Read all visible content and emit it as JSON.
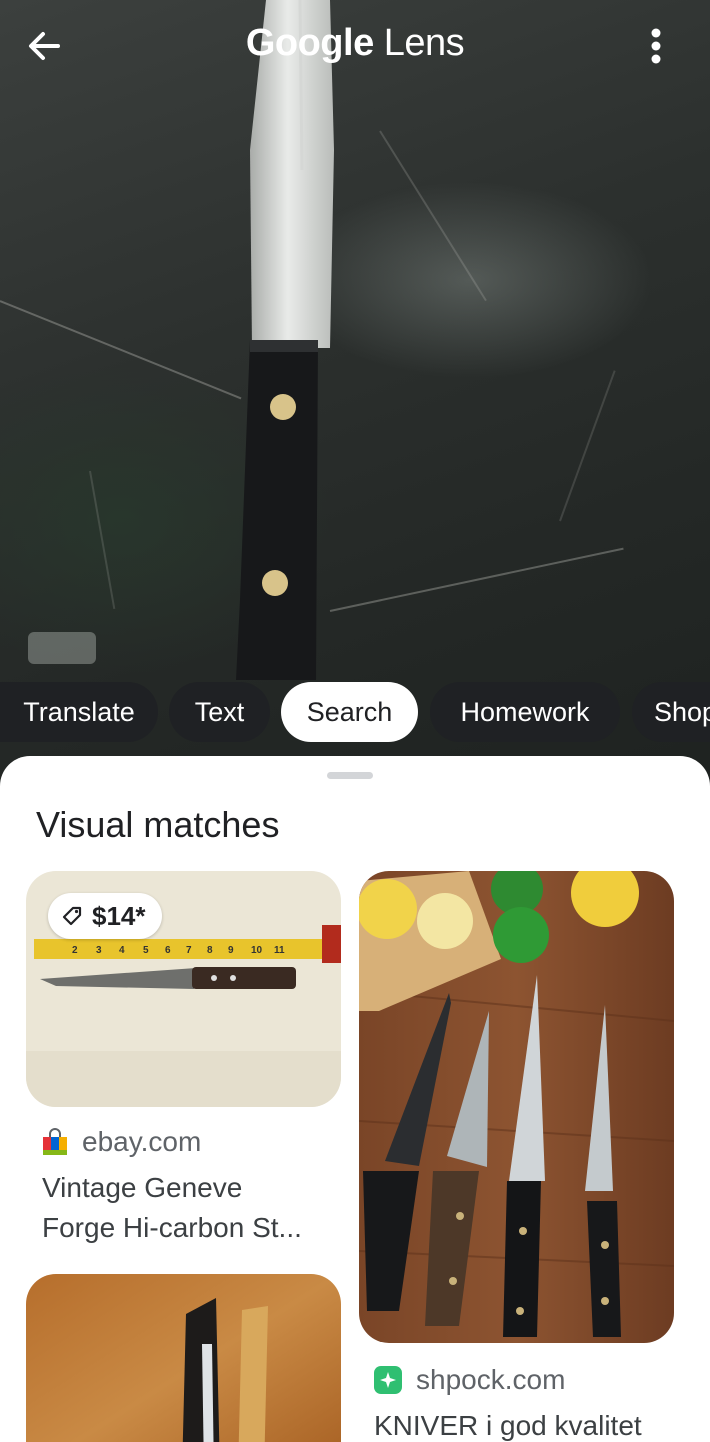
{
  "header": {
    "brand": "Google",
    "product": "Lens"
  },
  "icons": {
    "back": "arrow-left-icon",
    "menu": "more-vert-icon",
    "price": "tag-icon",
    "ebay": "shopping-bag-icon",
    "shpock": "shpock-icon"
  },
  "chips": [
    {
      "label": "Translate",
      "active": false
    },
    {
      "label": "Text",
      "active": false
    },
    {
      "label": "Search",
      "active": true
    },
    {
      "label": "Homework",
      "active": false
    },
    {
      "label": "Shopping",
      "active": false
    }
  ],
  "sheet": {
    "title": "Visual matches"
  },
  "results": [
    {
      "price": "$14*",
      "source": "ebay.com",
      "title_line1": "Vintage Geneve",
      "title_line2": "Forge Hi-carbon St..."
    },
    {
      "source": "shpock.com",
      "title_line1": "KNIVER i god kvalitet"
    }
  ],
  "ruler_marks": [
    "2",
    "3",
    "4",
    "5",
    "6",
    "7",
    "8",
    "9",
    "10",
    "11"
  ],
  "colors": {
    "chip_bg": "#1f2124",
    "chip_active_bg": "#ffffff",
    "shpock_green": "#2fbf71"
  }
}
